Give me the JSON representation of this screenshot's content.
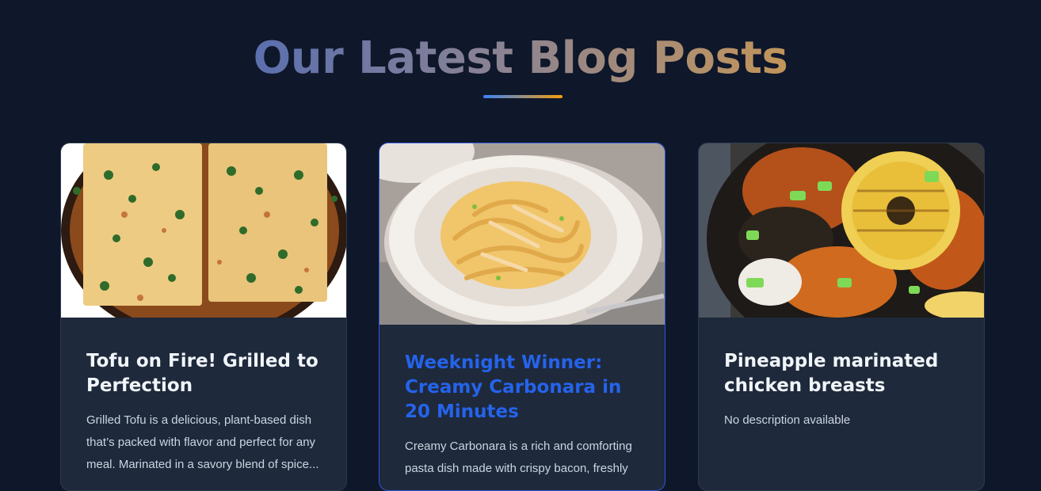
{
  "section": {
    "title": "Our Latest Blog Posts"
  },
  "posts": [
    {
      "title": "Tofu on Fire! Grilled to Perfection",
      "description": "Grilled Tofu is a delicious, plant-based dish that’s packed with flavor and perfect for any meal. Marinated in a savory blend of spice...",
      "image": "grilled-tofu-with-herbs-photo"
    },
    {
      "title": "Weeknight Winner: Creamy Carbonara in 20 Minutes",
      "description": "Creamy Carbonara is a rich and comforting pasta dish made with crispy bacon, freshly",
      "image": "creamy-carbonara-pasta-photo"
    },
    {
      "title": "Pineapple marinated chicken breasts",
      "description": "No description available",
      "image": "pineapple-chicken-photo"
    }
  ],
  "colors": {
    "background": "#0f172a",
    "card_background": "#1e293b",
    "accent_blue": "#2563eb",
    "accent_orange": "#f59e0b"
  }
}
